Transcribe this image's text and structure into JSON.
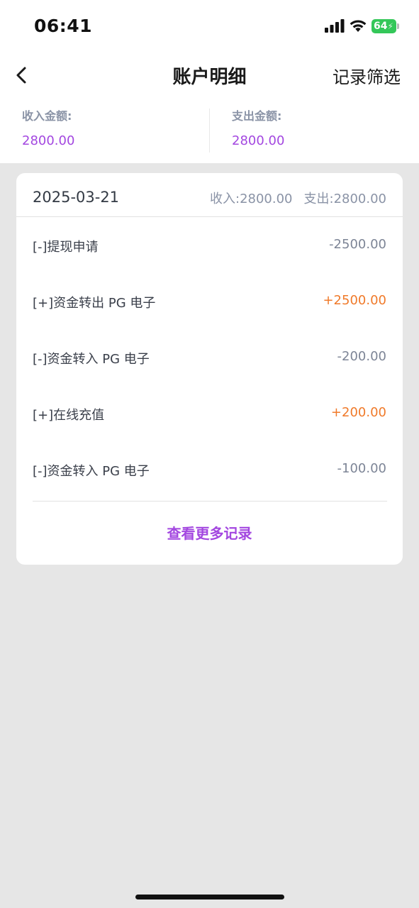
{
  "status_bar": {
    "time": "06:41",
    "battery_level": "64",
    "battery_color": "#34c759",
    "icons": [
      "signal-icon",
      "wifi-icon",
      "battery-icon",
      "charging-bolt-icon"
    ]
  },
  "nav": {
    "back_icon": "chevron-left-icon",
    "title": "账户明细",
    "filter_label": "记录筛选"
  },
  "summary": {
    "income_label": "收入金额:",
    "income_value": "2800.00",
    "expense_label": "支出金额:",
    "expense_value": "2800.00",
    "accent_color": "#a347e0"
  },
  "card": {
    "date": "2025-03-21",
    "income_total": "收入:2800.00",
    "expense_total": "支出:2800.00",
    "records": [
      {
        "label": "[-]提现申请",
        "amount": "-2500.00",
        "type": "negative"
      },
      {
        "label": "[+]资金转出 PG 电子",
        "amount": "+2500.00",
        "type": "positive"
      },
      {
        "label": "[-]资金转入 PG 电子",
        "amount": "-200.00",
        "type": "negative"
      },
      {
        "label": "[+]在线充值",
        "amount": "+200.00",
        "type": "positive"
      },
      {
        "label": "[-]资金转入 PG 电子",
        "amount": "-100.00",
        "type": "negative"
      }
    ],
    "more_label": "查看更多记录",
    "positive_color": "#f07a2a",
    "negative_color": "#7d8596"
  }
}
